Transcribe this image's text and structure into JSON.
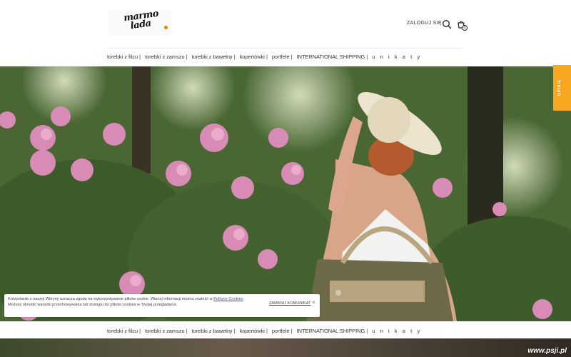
{
  "brand": {
    "logo_line1": "marmo",
    "logo_line2": "lada",
    "accent_color": "#e8850c"
  },
  "header": {
    "login_label": "ZALOGUJ SIĘ",
    "search_icon": "search-icon",
    "cart_icon": "cart-icon",
    "cart_count": "0"
  },
  "nav": {
    "items": [
      "torebki z filcu |",
      "torebki z zamszu |",
      "torebki z bawełny |",
      "kopertówki |",
      "portfele |",
      "INTERNATIONAL SHIPPING |",
      "u n i k a t y"
    ]
  },
  "reviews_tab": {
    "label": "OPINIE",
    "color": "#f7a81e"
  },
  "cookie_notice": {
    "text_line1": "Korzystanie z naszej Witryny oznacza zgodę na wykorzystywanie plików cookie. Więcej informacji można znaleźć w",
    "link_text": "Polityce Cookies",
    "text_line2": "Możesz określić warunki przechowywania lub dostępu do plików cookies w Twojej przeglądarce.",
    "close_label": "ZAMKNIJ KOMUNIKAT",
    "close_icon": "×"
  },
  "watermark": "www.psji.pl"
}
